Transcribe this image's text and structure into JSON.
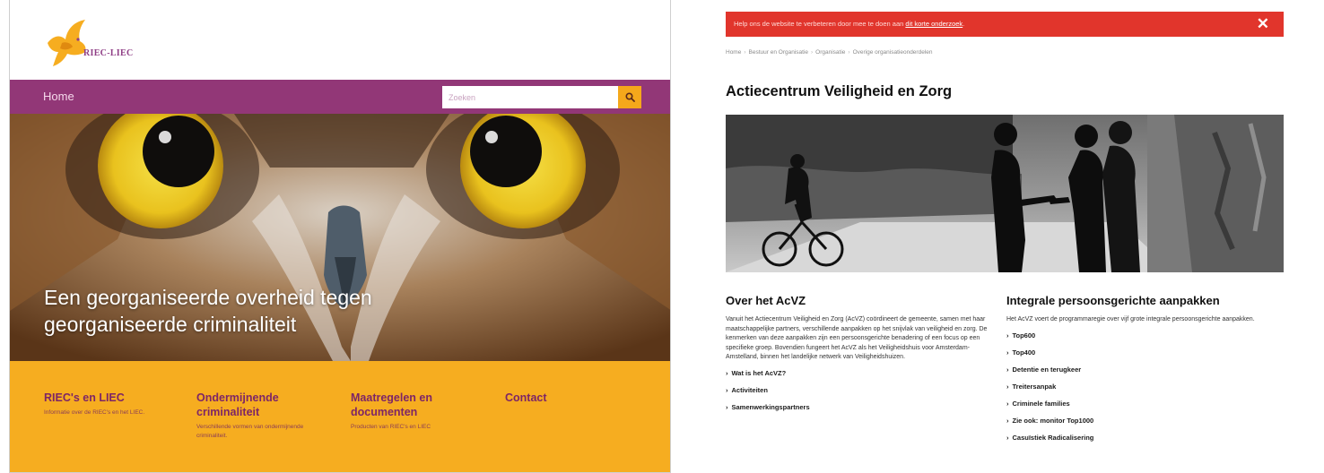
{
  "left_site": {
    "logo_text": "RIEC-LIEC",
    "nav": {
      "home_label": "Home"
    },
    "search": {
      "placeholder": "Zoeken"
    },
    "hero": {
      "headline_line1": "Een georganiseerde overheid tegen",
      "headline_line2": "georganiseerde criminaliteit"
    },
    "footer_links": [
      {
        "title": "RIEC's en LIEC",
        "desc": "Informatie over de RIEC's en het LIEC."
      },
      {
        "title": "Ondermijnende criminaliteit",
        "desc": "Verschillende vormen van ondermijnende criminaliteit."
      },
      {
        "title": "Maatregelen en documenten",
        "desc": "Producten van RIEC's en LIEC"
      },
      {
        "title": "Contact",
        "desc": ""
      }
    ],
    "colors": {
      "brand_purple": "#923777",
      "accent_yellow": "#f6ad20"
    }
  },
  "right_site": {
    "alert": {
      "text": "Help ons de website te verbeteren door mee te doen aan ",
      "link": "dit korte onderzoek",
      "end": "."
    },
    "breadcrumb": [
      "Home",
      "Bestuur en Organisatie",
      "Organisatie",
      "Overige organisatieonderdelen"
    ],
    "page_title": "Actiecentrum Veiligheid en Zorg",
    "about": {
      "heading": "Over het AcVZ",
      "body": "Vanuit het Actiecentrum Veiligheid en Zorg (AcVZ) coördineert de gemeente, samen met haar maatschappelijke partners, verschillende aanpakken op het snijvlak van veiligheid en zorg. De kenmerken van deze aanpakken zijn een persoonsgerichte benadering of een focus op een specifieke groep. Bovendien fungeert het AcVZ als het Veiligheidshuis voor Amsterdam-Amstelland, binnen het landelijke netwerk van Veiligheidshuizen.",
      "links": [
        "Wat is het AcVZ?",
        "Activiteiten",
        "Samenwerkingspartners"
      ]
    },
    "integral": {
      "heading": "Integrale persoonsgerichte aanpakken",
      "body": "Het AcVZ voert de programmaregie over vijf grote integrale persoonsgerichte aanpakken.",
      "links": [
        "Top600",
        "Top400",
        "Detentie en terugkeer",
        "Treitersanpak",
        "Criminele families",
        "Zie ook: monitor Top1000",
        "Casuïstiek Radicalisering"
      ]
    },
    "colors": {
      "alert_red": "#e1352c"
    }
  }
}
